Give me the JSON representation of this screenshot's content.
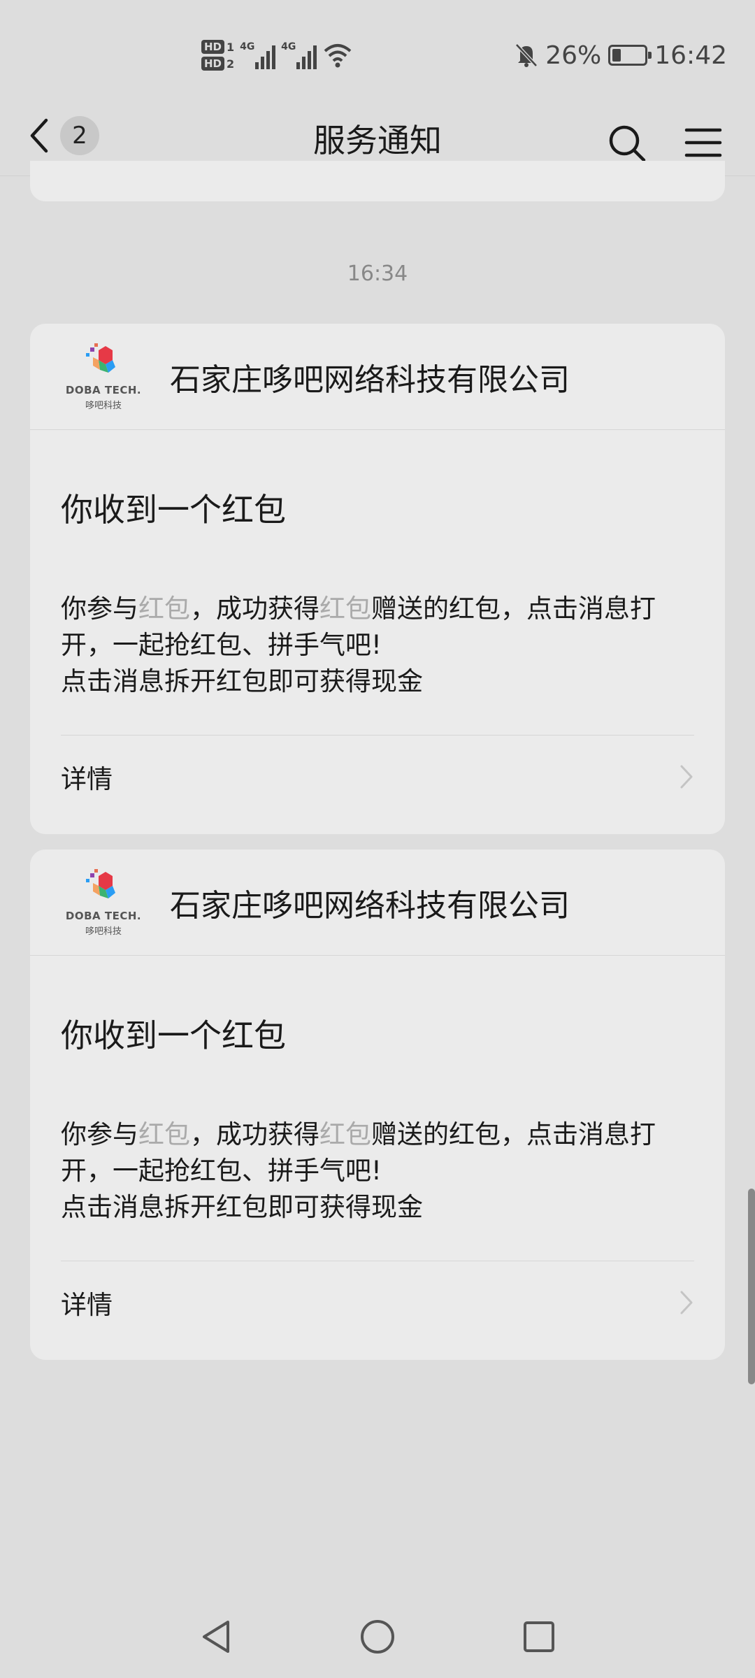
{
  "status_bar": {
    "sim1": "HD",
    "sim1_num": "1",
    "sim2": "HD",
    "sim2_num": "2",
    "net1": "4G",
    "net2": "4G",
    "battery_percent": "26%",
    "battery_level": 0.26,
    "time": "16:42",
    "icons": [
      "signal-icon",
      "wifi-icon",
      "mute-bell-icon",
      "battery-icon"
    ]
  },
  "header": {
    "back_count": "2",
    "title": "服务通知",
    "icons": [
      "back-chevron-icon",
      "search-icon",
      "menu-icon"
    ]
  },
  "timestamp": "16:34",
  "messages": [
    {
      "logo_text": "DOBA TECH.",
      "logo_subtext": "哆吧科技",
      "company": "石家庄哆吧网络科技有限公司",
      "title": "你收到一个红包",
      "body": {
        "p1": "你参与",
        "p2": "红包",
        "p3": "，成功获得",
        "p4": "红包",
        "p5": "赠送的红包，点击消息打开，一起抢红包、拼手气吧!",
        "line2": "点击消息拆开红包即可获得现金"
      },
      "details_label": "详情"
    },
    {
      "logo_text": "DOBA TECH.",
      "logo_subtext": "哆吧科技",
      "company": "石家庄哆吧网络科技有限公司",
      "title": "你收到一个红包",
      "body": {
        "p1": "你参与",
        "p2": "红包",
        "p3": "，成功获得",
        "p4": "红包",
        "p5": "赠送的红包，点击消息打开，一起抢红包、拼手气吧!",
        "line2": "点击消息拆开红包即可获得现金"
      },
      "details_label": "详情"
    }
  ],
  "system_nav": [
    "back-triangle-icon",
    "home-circle-icon",
    "recents-square-icon"
  ]
}
